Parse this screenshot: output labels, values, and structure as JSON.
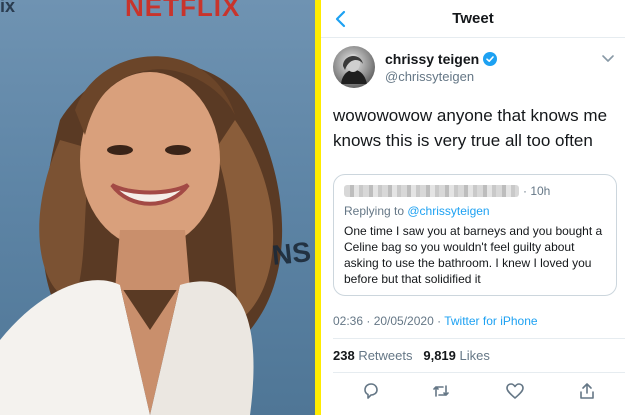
{
  "photo": {
    "brand_text": "NETFLIX",
    "edge_text": "ix",
    "backdrop_text": "NS"
  },
  "tweet_view": {
    "header_title": "Tweet",
    "back_icon": "chevron-left-icon",
    "author": {
      "name": "chrissy teigen",
      "handle": "@chrissyteigen",
      "verified": true
    },
    "text": "wowowowow anyone that knows me knows this is very true all too often",
    "quoted": {
      "time": "· 10h",
      "reply_prefix": "Replying to ",
      "reply_to": "@chrissyteigen",
      "body": "One time I saw you at barneys and you bought a Celine bag so you wouldn't feel guilty about asking to use the bathroom. I knew I loved you before but that solidified it"
    },
    "meta": {
      "timestamp": "02:36 · 20/05/2020 · ",
      "client": "Twitter for iPhone"
    },
    "stats": {
      "retweets_count": "238",
      "retweets_label": " Retweets",
      "likes_count": "9,819",
      "likes_label": " Likes"
    },
    "actions": [
      "reply-icon",
      "retweet-icon",
      "like-icon",
      "share-icon"
    ]
  },
  "colors": {
    "accent": "#1da1f2",
    "divider": "#ffec00",
    "brand": "#c8342c"
  }
}
